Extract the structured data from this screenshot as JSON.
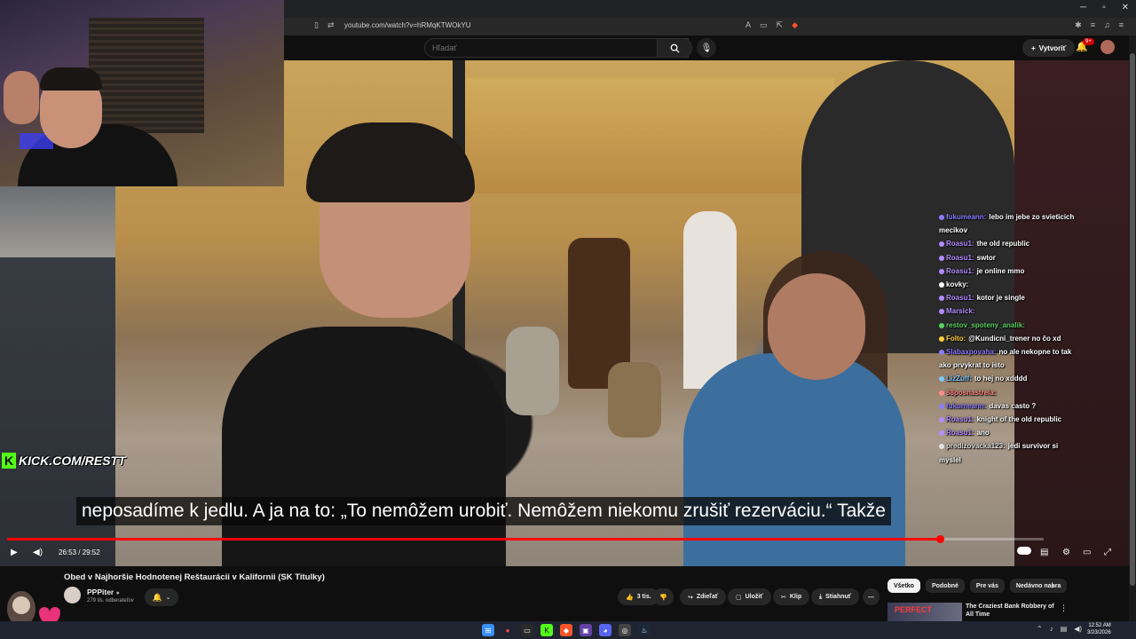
{
  "browser": {
    "url": "youtube.com/watch?v=hRMqKTWOkYU"
  },
  "youtube": {
    "search_placeholder": "Hľadať",
    "create_label": "Vytvoriť",
    "notification_count": "9+"
  },
  "overlay": {
    "kick_label": "KICK.COM/RESTT"
  },
  "chat": [
    {
      "user": "fukumeann:",
      "text": "lebo im jebe zo svieticich mecikov",
      "user_color": "#8b7cff"
    },
    {
      "user": "Roasu1:",
      "text": "the old republic",
      "user_color": "#b48cff"
    },
    {
      "user": "Roasu1:",
      "text": "swtor",
      "user_color": "#b48cff"
    },
    {
      "user": "Roasu1:",
      "text": "je online mmo",
      "user_color": "#b48cff"
    },
    {
      "user": "kovky:",
      "text": "",
      "user_color": "#ffffff"
    },
    {
      "user": "Roasu1:",
      "text": "kotor je single",
      "user_color": "#b48cff"
    },
    {
      "user": "Marsick:",
      "text": "",
      "user_color": "#b48cff"
    },
    {
      "user": "restov_spoteny_analik:",
      "text": "",
      "user_color": "#59d15f"
    },
    {
      "user": "Folto:",
      "text": "@Kundicni_trener no čo xd",
      "user_color": "#ffd23c"
    },
    {
      "user": "Slabaxpovaha:",
      "text": "no ale nekopne to tak ako prvykrat to isto",
      "user_color": "#8b7cff"
    },
    {
      "user": "LizZuff:",
      "text": "to hej no xdddd",
      "user_color": "#7ec8ff"
    },
    {
      "user": "88posnastrela:",
      "text": "",
      "user_color": "#ff8a8a"
    },
    {
      "user": "fukumeann:",
      "text": "davas casto ?",
      "user_color": "#8b7cff"
    },
    {
      "user": "Roasu1:",
      "text": "knight of the old republic",
      "user_color": "#b48cff"
    },
    {
      "user": "Roasu1:",
      "text": "ano",
      "user_color": "#b48cff"
    },
    {
      "user": "predizovacka123:",
      "text": "jedi survivor si myslel",
      "user_color": "#dfdfdf"
    }
  ],
  "subtitle": "neposadíme k jedlu. A ja na to: „To nemôžem urobiť. Nemôžem niekomu zrušiť rezerváciu.“ Takže",
  "player": {
    "time_display": "26:53 / 29:52",
    "progress_fraction": 0.9
  },
  "video": {
    "title": "Obed v Najhoršie Hodnotenej Reštaurácii v Kalifornii (SK Titulky)",
    "channel": "PPPiter",
    "subscribers": "279 tis. odberateľov",
    "likes": "3 tis.",
    "share_label": "Zdieľať",
    "save_label": "Uložiť",
    "clip_label": "Klip",
    "download_label": "Stiahnuť"
  },
  "chips": [
    "Všetko",
    "Podobné",
    "Pre vás",
    "Nedávno nahra"
  ],
  "recommendation": {
    "thumb_text": "PERFECT",
    "title": "The Craziest Bank Robbery of All Time"
  },
  "taskbar": {
    "time": "12:52 AM",
    "date": "3/23/2026"
  }
}
